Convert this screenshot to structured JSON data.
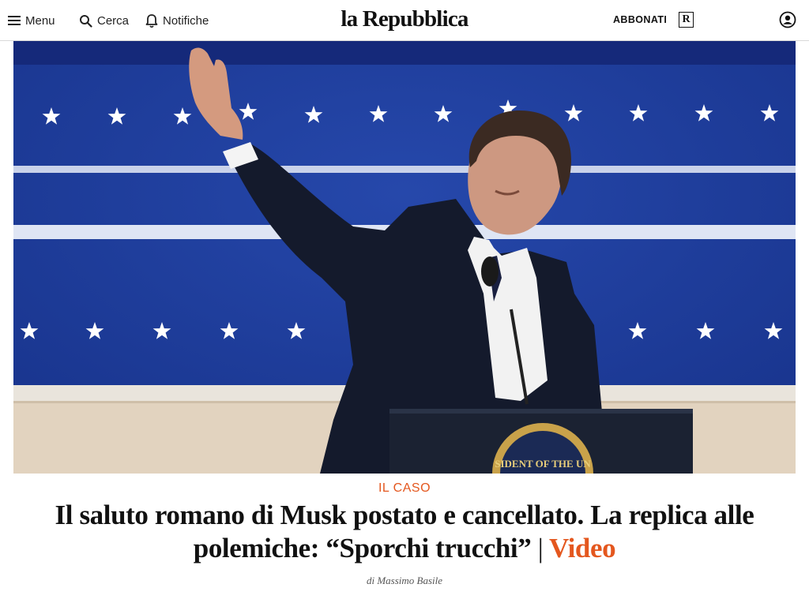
{
  "header": {
    "menu_label": "Menu",
    "search_label": "Cerca",
    "notifications_label": "Notifiche",
    "logo": "la Repubblica",
    "subscribe_label": "ABBONATI",
    "premium_badge": "R"
  },
  "article": {
    "kicker": "IL CASO",
    "headline": "Il saluto romano di Musk postato e cancellato. La replica alle polemiche: “Sporchi trucchi”",
    "separator": "|",
    "video_label": "Video",
    "byline_prefix": "di",
    "author": "Massimo Basile",
    "seal_text": "SIDENT OF THE UN"
  },
  "colors": {
    "accent": "#e4571e",
    "backdrop_blue": "#1f3f9c",
    "suit": "#141a2c"
  }
}
